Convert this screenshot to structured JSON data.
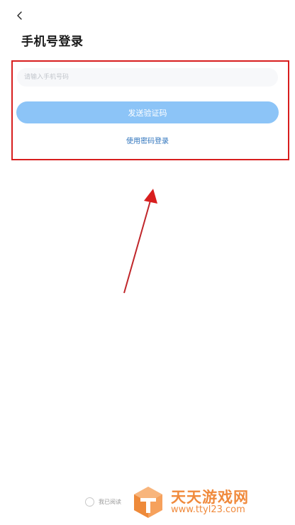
{
  "header": {
    "back_icon": "chevron-left-icon",
    "title": "手机号登录"
  },
  "form": {
    "phone_placeholder": "请输入手机号码",
    "phone_value": "",
    "send_code_label": "发送验证码",
    "password_login_label": "使用密码登录"
  },
  "footer": {
    "agreement_text": "我已阅读",
    "agreement_checked": false
  },
  "watermark": {
    "title": "天天游戏网",
    "url": "www.ttyl23.com"
  },
  "colors": {
    "primary_button": "#8cc4f7",
    "link": "#2f74bd",
    "annotation_red": "#d81e1e",
    "watermark_orange": "#f08a3c"
  }
}
